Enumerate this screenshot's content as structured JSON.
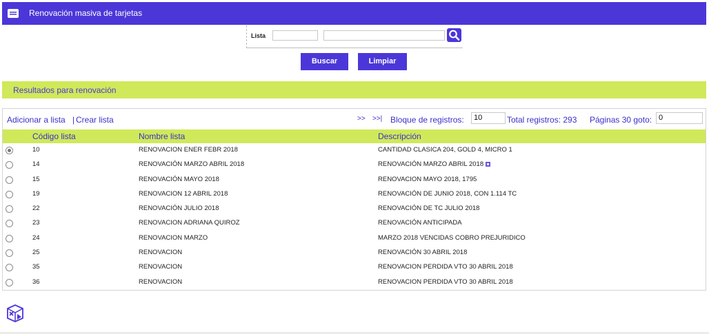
{
  "title": "Renovación masiva de tarjetas",
  "search": {
    "label": "Lista",
    "input1_value": "",
    "input2_value": ""
  },
  "buttons": {
    "buscar": "Buscar",
    "limpiar": "Limpiar"
  },
  "results": {
    "title": "Resultados para renovación"
  },
  "toolbar": {
    "add_link": "Adicionar a lista",
    "separator": "|",
    "create_link": "Crear lista",
    "next": ">>",
    "last": ">>|",
    "block_label": "Bloque de registros:",
    "block_value": "10",
    "total_label": "Total registros: 293",
    "pages_label": "Páginas 30 goto:",
    "goto_value": "0"
  },
  "table": {
    "headers": [
      "Código lista",
      "Nombre lista",
      "Descripción"
    ],
    "rows": [
      {
        "code": "10",
        "name": "RENOVACION ENER FEBR 2018",
        "desc": "CANTIDAD CLASICA 204, GOLD 4, MICRO 1",
        "selected": true
      },
      {
        "code": "14",
        "name": "RENOVACIÓN MARZO ABRIL 2018",
        "desc": "RENOVACIÓN MARZO ABRIL 2018",
        "expand_icon": "plus-icon"
      },
      {
        "code": "15",
        "name": "RENOVACIÓN MAYO 2018",
        "desc": "RENOVACION MAYO 2018, 1795"
      },
      {
        "code": "19",
        "name": "RENOVACION 12 ABRIL 2018",
        "desc": "RENOVACIÓN DE JUNIO 2018, CON 1.114 TC"
      },
      {
        "code": "22",
        "name": "RENOVACIÓN JULIO 2018",
        "desc": "RENOVACIÓN DE TC JULIO 2018"
      },
      {
        "code": "23",
        "name": "RENOVACION ADRIANA QUIROZ",
        "desc": "RENOVACIÓN ANTICIPADA"
      },
      {
        "code": "24",
        "name": "RENOVACION MARZO",
        "desc": "MARZO 2018 VENCIDAS COBRO PREJURIDICO"
      },
      {
        "code": "25",
        "name": "RENOVACION",
        "desc": "RENOVACIÓN 30 ABRIL 2018"
      },
      {
        "code": "35",
        "name": "RENOVACION",
        "desc": "RENOVACION PERDIDA VTO 30 ABRIL 2018"
      },
      {
        "code": "36",
        "name": "RENOVACION",
        "desc": "RENOVACION PERDIDA VTO 30 ABRIL 2018"
      }
    ]
  },
  "colors": {
    "primary": "#4b37d8",
    "accent_green": "#cfe95a",
    "link": "#3a30c8"
  },
  "icons": {
    "title": "card-list-icon",
    "search": "search-icon",
    "bottom": "file-export-icon"
  }
}
